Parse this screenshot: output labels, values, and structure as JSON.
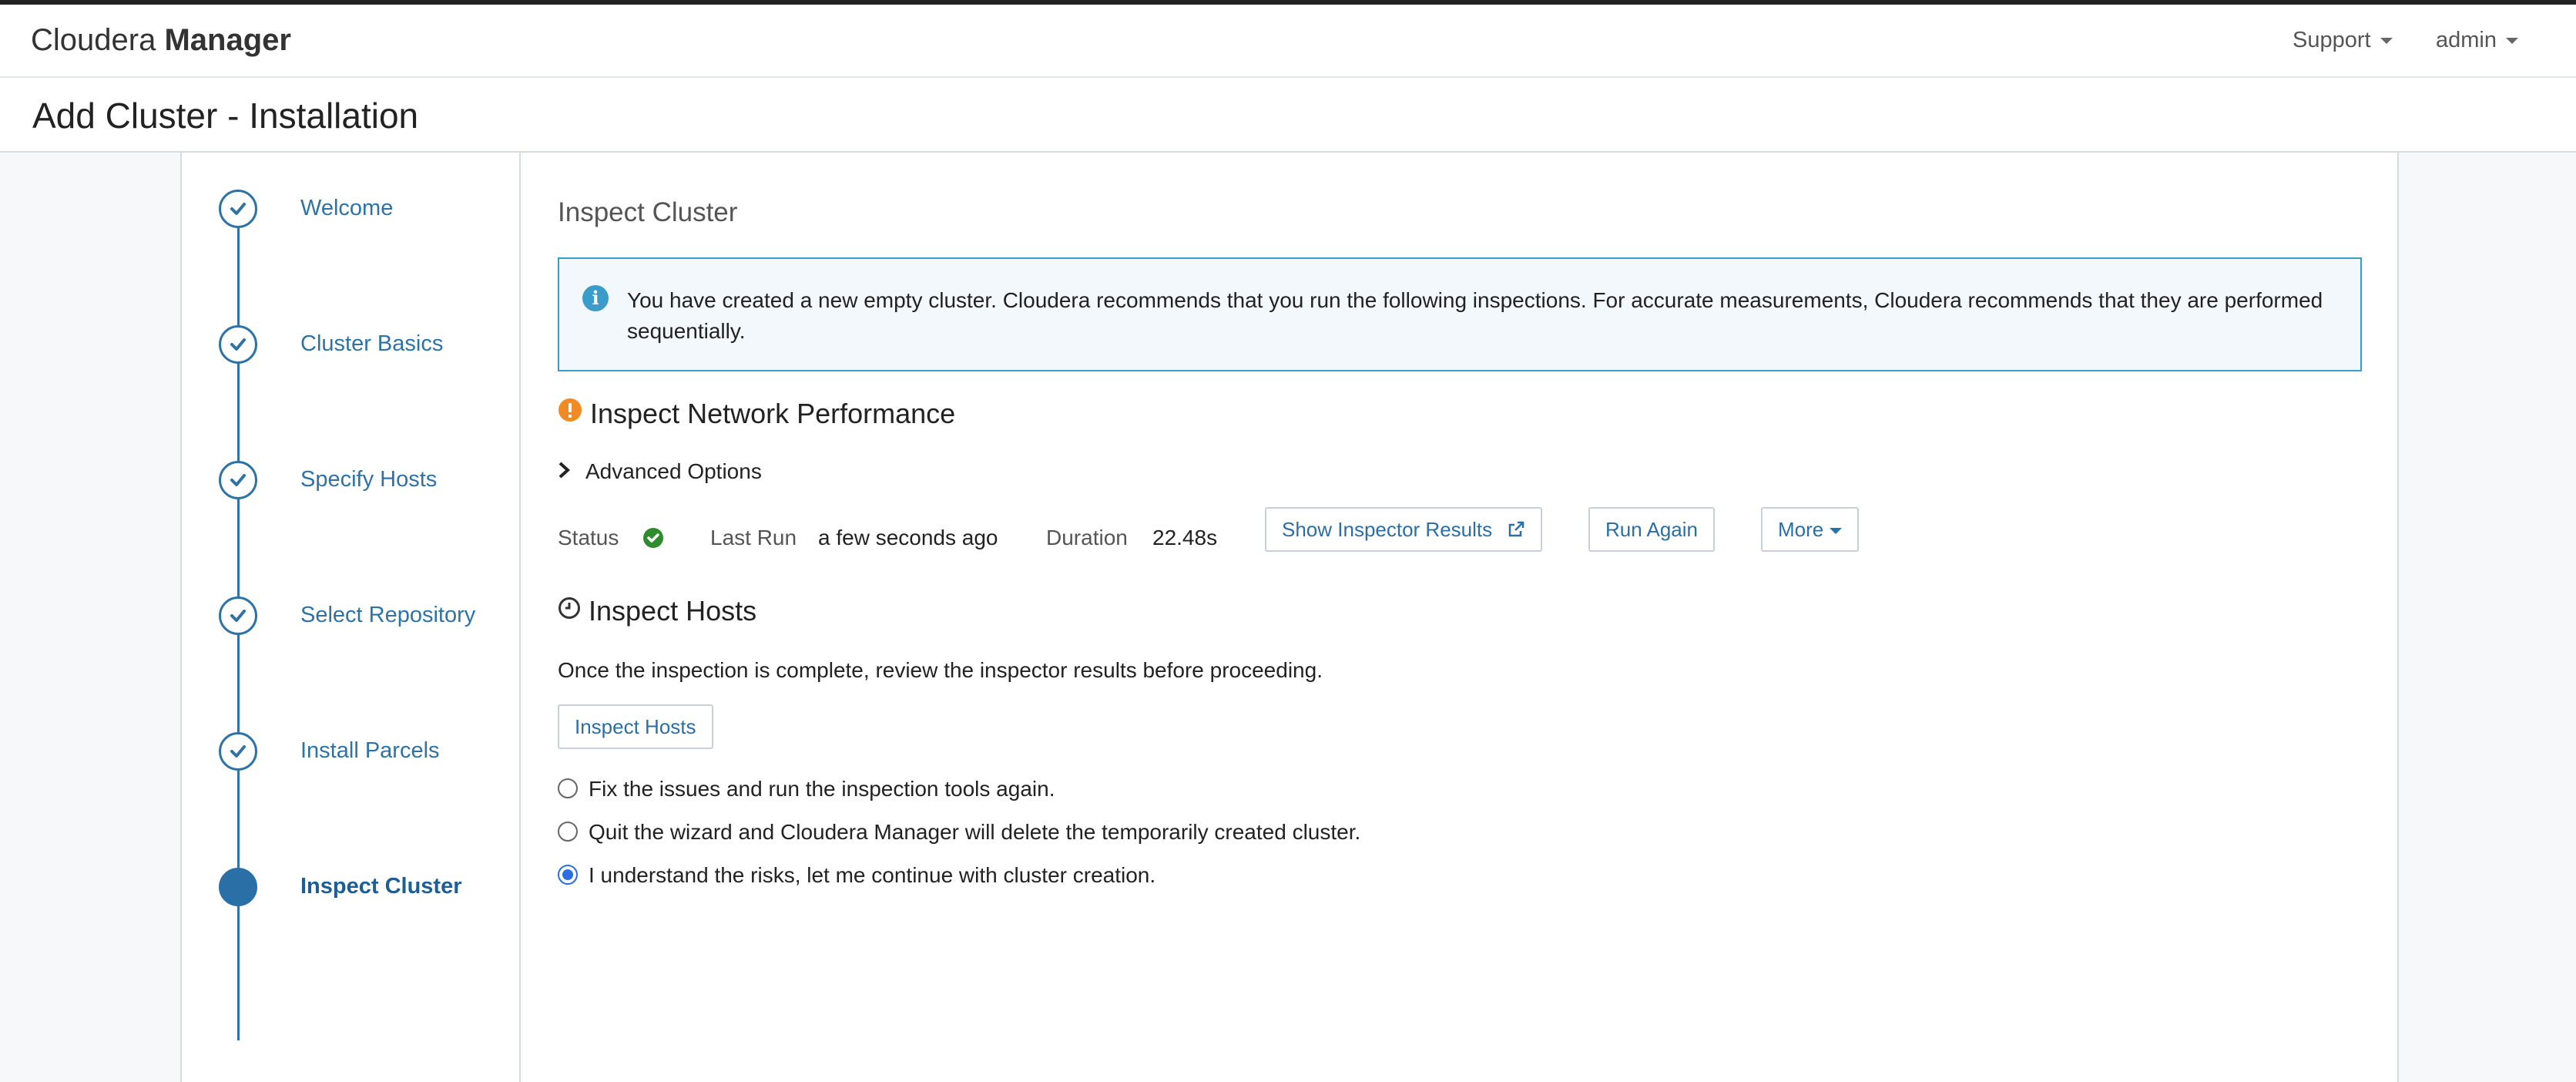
{
  "app": {
    "brand_light": "Cloudera",
    "brand_bold": "Manager",
    "nav": {
      "support_label": "Support",
      "user_label": "admin"
    }
  },
  "page": {
    "title": "Add Cluster - Installation"
  },
  "wizard": {
    "steps": [
      {
        "label": "Welcome",
        "state": "done"
      },
      {
        "label": "Cluster Basics",
        "state": "done"
      },
      {
        "label": "Specify Hosts",
        "state": "done"
      },
      {
        "label": "Select Repository",
        "state": "done"
      },
      {
        "label": "Install Parcels",
        "state": "done"
      },
      {
        "label": "Inspect Cluster",
        "state": "current"
      }
    ]
  },
  "main": {
    "section_title": "Inspect Cluster",
    "alert_text": "You have created a new empty cluster. Cloudera recommends that you run the following inspections. For accurate measurements, Cloudera recommends that they are performed sequentially.",
    "network": {
      "title": "Inspect Network Performance",
      "advanced_label": "Advanced Options",
      "status_label": "Status",
      "last_run_label": "Last Run",
      "last_run_value": "a few seconds ago",
      "duration_label": "Duration",
      "duration_value": "22.48s",
      "show_results_label": "Show Inspector Results",
      "run_again_label": "Run Again",
      "more_label": "More"
    },
    "hosts": {
      "title": "Inspect Hosts",
      "description": "Once the inspection is complete, review the inspector results before proceeding.",
      "button_label": "Inspect Hosts",
      "options": [
        {
          "label": "Fix the issues and run the inspection tools again.",
          "checked": false
        },
        {
          "label": "Quit the wizard and Cloudera Manager will delete the temporarily created cluster.",
          "checked": false
        },
        {
          "label": "I understand the risks, let me continue with cluster creation.",
          "checked": true
        }
      ]
    }
  },
  "colors": {
    "accent": "#2f73a6",
    "warning": "#f08a24",
    "success": "#2e8b2e",
    "info": "#3a9dc9"
  }
}
